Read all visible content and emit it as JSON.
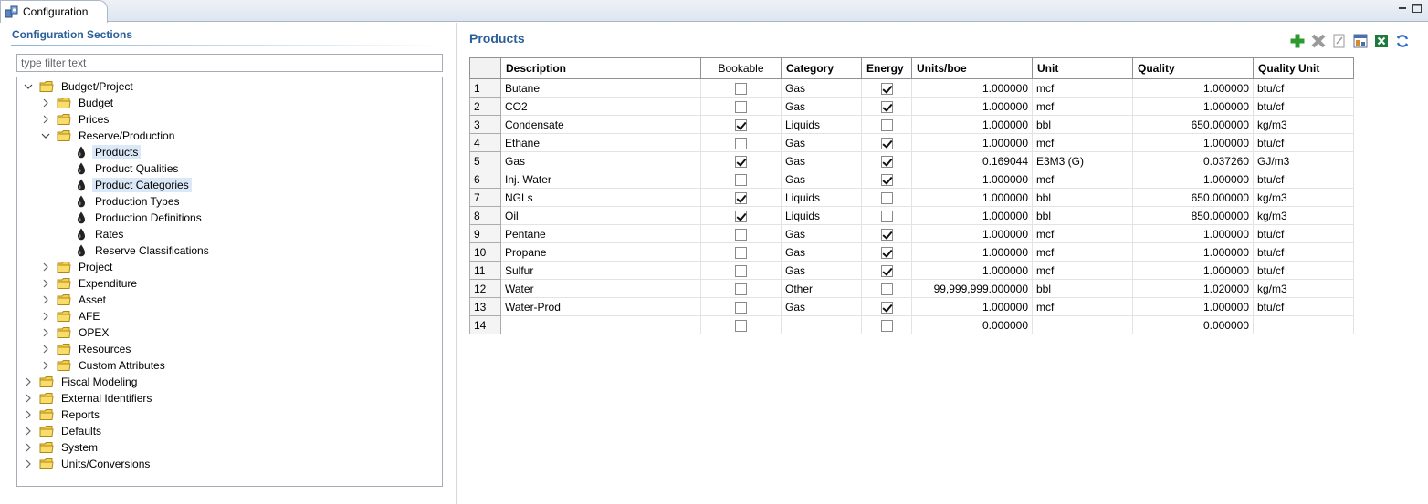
{
  "window": {
    "tab_title": "Configuration"
  },
  "left": {
    "section_title": "Configuration Sections",
    "filter_placeholder": "type filter text",
    "tree": [
      {
        "label": "Budget/Project",
        "level": 0,
        "type": "folder",
        "expanded": true
      },
      {
        "label": "Budget",
        "level": 1,
        "type": "folder",
        "expanded": false
      },
      {
        "label": "Prices",
        "level": 1,
        "type": "folder",
        "expanded": false
      },
      {
        "label": "Reserve/Production",
        "level": 1,
        "type": "folder",
        "expanded": true
      },
      {
        "label": "Products",
        "level": 2,
        "type": "leaf",
        "selected": true
      },
      {
        "label": "Product Qualities",
        "level": 2,
        "type": "leaf"
      },
      {
        "label": "Product Categories",
        "level": 2,
        "type": "leaf",
        "selected": true
      },
      {
        "label": "Production Types",
        "level": 2,
        "type": "leaf"
      },
      {
        "label": "Production Definitions",
        "level": 2,
        "type": "leaf"
      },
      {
        "label": "Rates",
        "level": 2,
        "type": "leaf"
      },
      {
        "label": "Reserve Classifications",
        "level": 2,
        "type": "leaf"
      },
      {
        "label": "Project",
        "level": 1,
        "type": "folder",
        "expanded": false
      },
      {
        "label": "Expenditure",
        "level": 1,
        "type": "folder",
        "expanded": false
      },
      {
        "label": "Asset",
        "level": 1,
        "type": "folder",
        "expanded": false
      },
      {
        "label": "AFE",
        "level": 1,
        "type": "folder",
        "expanded": false
      },
      {
        "label": "OPEX",
        "level": 1,
        "type": "folder",
        "expanded": false
      },
      {
        "label": "Resources",
        "level": 1,
        "type": "folder",
        "expanded": false
      },
      {
        "label": "Custom Attributes",
        "level": 1,
        "type": "folder",
        "expanded": false
      },
      {
        "label": "Fiscal Modeling",
        "level": 0,
        "type": "folder",
        "expanded": false
      },
      {
        "label": "External Identifiers",
        "level": 0,
        "type": "folder",
        "expanded": false
      },
      {
        "label": "Reports",
        "level": 0,
        "type": "folder",
        "expanded": false
      },
      {
        "label": "Defaults",
        "level": 0,
        "type": "folder",
        "expanded": false
      },
      {
        "label": "System",
        "level": 0,
        "type": "folder",
        "expanded": false
      },
      {
        "label": "Units/Conversions",
        "level": 0,
        "type": "folder",
        "expanded": false
      }
    ]
  },
  "right": {
    "title": "Products",
    "toolbar": [
      {
        "name": "add-icon",
        "color": "#2e9a2e"
      },
      {
        "name": "delete-icon",
        "color": "#9a9a9a"
      },
      {
        "name": "edit-icon",
        "color": "#9a9a9a"
      },
      {
        "name": "report-icon",
        "color": "#d98a2b"
      },
      {
        "name": "excel-export-icon",
        "color": "#1e7a3a"
      },
      {
        "name": "refresh-icon",
        "color": "#2a6fc4"
      }
    ],
    "columns": [
      "Description",
      "Bookable",
      "Category",
      "Energy",
      "Units/boe",
      "Unit",
      "Quality",
      "Quality Unit"
    ],
    "rows": [
      {
        "n": "1",
        "description": "Butane",
        "bookable": false,
        "category": "Gas",
        "energy": true,
        "units_boe": "1.000000",
        "unit": "mcf",
        "quality": "1.000000",
        "quality_unit": "btu/cf"
      },
      {
        "n": "2",
        "description": "CO2",
        "bookable": false,
        "category": "Gas",
        "energy": true,
        "units_boe": "1.000000",
        "unit": "mcf",
        "quality": "1.000000",
        "quality_unit": "btu/cf"
      },
      {
        "n": "3",
        "description": "Condensate",
        "bookable": true,
        "category": "Liquids",
        "energy": false,
        "units_boe": "1.000000",
        "unit": "bbl",
        "quality": "650.000000",
        "quality_unit": "kg/m3"
      },
      {
        "n": "4",
        "description": "Ethane",
        "bookable": false,
        "category": "Gas",
        "energy": true,
        "units_boe": "1.000000",
        "unit": "mcf",
        "quality": "1.000000",
        "quality_unit": "btu/cf"
      },
      {
        "n": "5",
        "description": "Gas",
        "bookable": true,
        "category": "Gas",
        "energy": true,
        "units_boe": "0.169044",
        "unit": "E3M3 (G)",
        "quality": "0.037260",
        "quality_unit": "GJ/m3"
      },
      {
        "n": "6",
        "description": "Inj. Water",
        "bookable": false,
        "category": "Gas",
        "energy": true,
        "units_boe": "1.000000",
        "unit": "mcf",
        "quality": "1.000000",
        "quality_unit": "btu/cf"
      },
      {
        "n": "7",
        "description": "NGLs",
        "bookable": true,
        "category": "Liquids",
        "energy": false,
        "units_boe": "1.000000",
        "unit": "bbl",
        "quality": "650.000000",
        "quality_unit": "kg/m3"
      },
      {
        "n": "8",
        "description": "Oil",
        "bookable": true,
        "category": "Liquids",
        "energy": false,
        "units_boe": "1.000000",
        "unit": "bbl",
        "quality": "850.000000",
        "quality_unit": "kg/m3"
      },
      {
        "n": "9",
        "description": "Pentane",
        "bookable": false,
        "category": "Gas",
        "energy": true,
        "units_boe": "1.000000",
        "unit": "mcf",
        "quality": "1.000000",
        "quality_unit": "btu/cf"
      },
      {
        "n": "10",
        "description": "Propane",
        "bookable": false,
        "category": "Gas",
        "energy": true,
        "units_boe": "1.000000",
        "unit": "mcf",
        "quality": "1.000000",
        "quality_unit": "btu/cf"
      },
      {
        "n": "11",
        "description": "Sulfur",
        "bookable": false,
        "category": "Gas",
        "energy": true,
        "units_boe": "1.000000",
        "unit": "mcf",
        "quality": "1.000000",
        "quality_unit": "btu/cf"
      },
      {
        "n": "12",
        "description": "Water",
        "bookable": false,
        "category": "Other",
        "energy": false,
        "units_boe": "99,999,999.000000",
        "unit": "bbl",
        "quality": "1.020000",
        "quality_unit": "kg/m3"
      },
      {
        "n": "13",
        "description": "Water-Prod",
        "bookable": false,
        "category": "Gas",
        "energy": true,
        "units_boe": "1.000000",
        "unit": "mcf",
        "quality": "1.000000",
        "quality_unit": "btu/cf"
      },
      {
        "n": "14",
        "description": "",
        "bookable": false,
        "category": "",
        "energy": false,
        "units_boe": "0.000000",
        "unit": "",
        "quality": "0.000000",
        "quality_unit": ""
      }
    ]
  },
  "colors": {
    "accent_title": "#2b5f99",
    "selection": "#dbe8f8"
  }
}
